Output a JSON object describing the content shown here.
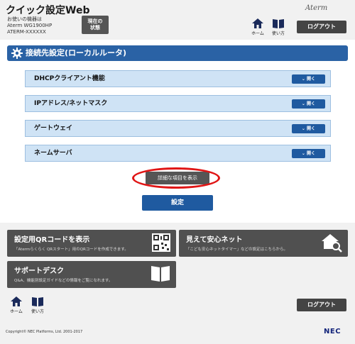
{
  "header": {
    "app_title": "クイック設定Web",
    "device_line1": "お使いの機器は",
    "device_line2": "Aterm WG1900HP",
    "device_line3": "ATERM-XXXXXX",
    "status_btn_line1": "現在の",
    "status_btn_line2": "状態",
    "brand": "Aterm",
    "home_label": "ホーム",
    "usage_label": "使い方",
    "logout_label": "ログアウト"
  },
  "main": {
    "section_title": "接続先設定(ローカルルータ)",
    "accordions": [
      {
        "label": "DHCPクライアント機能",
        "open_label": "開く"
      },
      {
        "label": "IPアドレス/ネットマスク",
        "open_label": "開く"
      },
      {
        "label": "ゲートウェイ",
        "open_label": "開く"
      },
      {
        "label": "ネームサーバ",
        "open_label": "開く"
      }
    ],
    "detail_label": "詳細な項目を表示",
    "submit_label": "設定"
  },
  "footer": {
    "cards": [
      {
        "title": "設定用QRコードを表示",
        "desc": "「Atermらくらく QRスタート」用のQRコードを作成できます。"
      },
      {
        "title": "見えて安心ネット",
        "desc": "「こども安心ネットタイマー」などの設定はこちらから。"
      },
      {
        "title": "サポートデスク",
        "desc": "Q&A、機能別設定ガイドなどの情報をご覧になれます。"
      }
    ],
    "home_label": "ホーム",
    "usage_label": "使い方",
    "logout_label": "ログアウト",
    "copyright": "Copyright© NEC Platforms, Ltd. 2001-2017",
    "nec_logo": "NEC"
  },
  "colors": {
    "primary_blue": "#2a62a5",
    "button_blue": "#1f5aa0",
    "accordion_bg": "#cfe3f5",
    "highlight_red": "#e01515",
    "dark_button": "#444444"
  }
}
